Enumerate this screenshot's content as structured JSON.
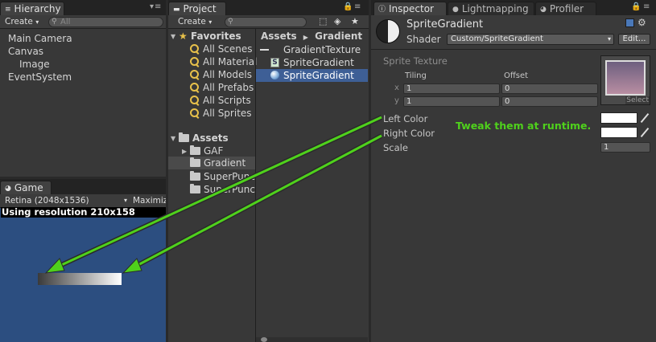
{
  "hierarchy": {
    "tab": "Hierarchy",
    "create_label": "Create",
    "search_placeholder": "All",
    "items": [
      "Main Camera",
      "Canvas",
      "Image",
      "EventSystem"
    ]
  },
  "game": {
    "tab": "Game",
    "resolution_select": "Retina (2048x1536)",
    "maximize_label": "Maximiz",
    "resolution_text": "Using resolution 210x158",
    "gradient_colors": [
      "#3a3a3a",
      "#ffffff"
    ]
  },
  "project": {
    "tab": "Project",
    "create_label": "Create",
    "favorites_header": "Favorites",
    "favorites": [
      "All Scenes",
      "All Material",
      "All Models",
      "All Prefabs",
      "All Scripts",
      "All Sprites"
    ],
    "assets_header": "Assets",
    "folders": [
      "GAF",
      "Gradient",
      "SuperPunc",
      "SuperPunc"
    ],
    "breadcrumb": [
      "Assets",
      "Gradient"
    ],
    "assets": [
      "GradientTexture",
      "SpriteGradient",
      "SpriteGradient"
    ]
  },
  "inspector": {
    "tabs": [
      "Inspector",
      "Lightmapping",
      "Profiler"
    ],
    "material_name": "SpriteGradient",
    "shader_label": "Shader",
    "shader_value": "Custom/SpriteGradient",
    "edit_button": "Edit...",
    "sprite_texture_label": "Sprite Texture",
    "tiling_label": "Tiling",
    "offset_label": "Offset",
    "x_label": "x",
    "y_label": "y",
    "tiling_x": "1",
    "tiling_y": "1",
    "offset_x": "0",
    "offset_y": "0",
    "select_label": "Select",
    "left_color_label": "Left Color",
    "right_color_label": "Right Color",
    "scale_label": "Scale",
    "scale_value": "1",
    "left_color": "#ffffff",
    "right_color": "#ffffff"
  },
  "annotation": {
    "text": "Tweak them at runtime.",
    "color": "#4fd11c"
  },
  "theme": {
    "selection": "#3e5f96",
    "game_bg": "#2c4e80"
  }
}
